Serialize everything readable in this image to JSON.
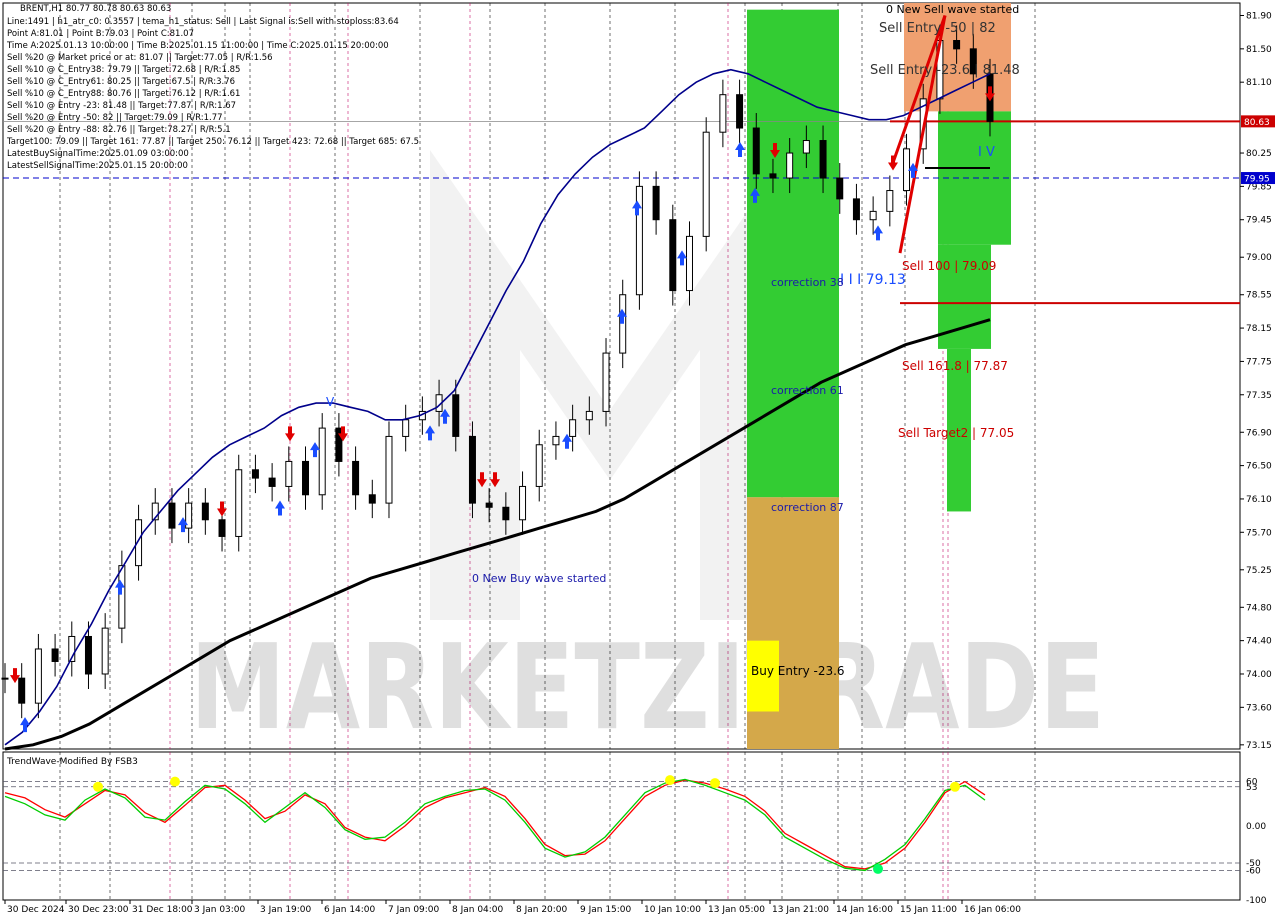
{
  "chart_data": [
    {
      "type": "line",
      "panel": "main",
      "symbol_header": "BRENT,H1  80.77 80.78 80.63 80.63",
      "info_lines": [
        "Line:1491 | h1_atr_c0: 0.3557 | tema_h1_status: Sell | Last Signal is:Sell with stoploss:83.64",
        "Point A:81.01 | Point B:79.03 | Point C:81.07",
        "Time A:2025.01.13 10:00:00 | Time B:2025.01.15 11:00:00 | Time C:2025.01.15 20:00:00",
        "Sell %20 @ Market price or at: 81.07 || Target:77.05 | R/R:1.56",
        "Sell %10 @ C_Entry38: 79.79 || Target:72.68 | R/R:1.85",
        "Sell %10 @ C_Entry61: 80.25 || Target:67.5 | R/R:3.76",
        "Sell %10 @ C_Entry88: 80.76 || Target:76.12 | R/R:1.61",
        "Sell %10 @ Entry -23: 81.48 || Target:77.87 | R/R:1.67",
        "Sell %20 @ Entry -50: 82 || Target:79.09 | R/R:1.77",
        "Sell %20 @ Entry -88: 82.76 || Target:78.27 | R/R:5.1",
        "Target100: 79.09 || Target 161: 77.87 || Target 250: 76.12 || Target 423: 72.68 || Target 685: 67.5",
        "LatestBuySignalTime:2025.01.09 03:00:00",
        "LatestSellSignalTime:2025.01.15 20:00:00"
      ],
      "y_ticks": [
        "81.90",
        "81.50",
        "81.10",
        "80.25",
        "79.85",
        "79.45",
        "79.00",
        "78.55",
        "78.15",
        "77.75",
        "77.35",
        "76.90",
        "76.50",
        "76.10",
        "75.70",
        "75.25",
        "74.80",
        "74.40",
        "74.00",
        "73.60",
        "73.15"
      ],
      "y_range": [
        73.1,
        82.05
      ],
      "x_ticks": [
        "30 Dec 2024",
        "30 Dec 23:00",
        "31 Dec 18:00",
        "3 Jan 03:00",
        "3 Jan 19:00",
        "6 Jan 14:00",
        "7 Jan 09:00",
        "8 Jan 04:00",
        "8 Jan 20:00",
        "9 Jan 15:00",
        "10 Jan 10:00",
        "13 Jan 05:00",
        "13 Jan 21:00",
        "14 Jan 16:00",
        "15 Jan 11:00",
        "16 Jan 06:00"
      ],
      "current_price": {
        "value": 80.63,
        "label": "80.63",
        "color": "#cc0000"
      },
      "dashed_level": {
        "value": 79.95,
        "label": "79.95",
        "color": "#0000cc"
      },
      "stop_level": {
        "value": 78.45,
        "color": "#cc0000"
      },
      "series": [
        {
          "name": "price",
          "color": "#000000",
          "values": [
            73.95,
            73.65,
            74.3,
            74.15,
            74.45,
            74.0,
            74.55,
            75.3,
            75.85,
            76.05,
            75.75,
            76.05,
            75.85,
            75.65,
            76.45,
            76.35,
            76.25,
            76.55,
            76.15,
            76.95,
            76.55,
            76.15,
            76.05,
            76.85,
            77.05,
            77.15,
            77.35,
            76.85,
            76.05,
            76.0,
            75.85,
            76.25,
            76.75,
            76.85,
            77.05,
            77.15,
            77.85,
            78.55,
            79.85,
            79.45,
            78.6,
            79.25,
            80.5,
            80.95,
            80.55,
            80.0,
            79.95,
            80.25,
            80.4,
            79.95,
            79.7,
            79.45,
            79.55,
            79.8,
            80.3,
            80.9,
            81.6,
            81.5,
            81.2,
            80.63
          ]
        },
        {
          "name": "ma-fast",
          "color": "#00008b",
          "values": [
            73.15,
            73.3,
            73.55,
            73.85,
            74.25,
            74.6,
            75.0,
            75.35,
            75.7,
            75.95,
            76.2,
            76.4,
            76.6,
            76.75,
            76.85,
            76.95,
            77.1,
            77.2,
            77.25,
            77.25,
            77.2,
            77.15,
            77.05,
            77.05,
            77.1,
            77.2,
            77.4,
            77.8,
            78.2,
            78.6,
            78.95,
            79.4,
            79.75,
            80.0,
            80.2,
            80.35,
            80.45,
            80.55,
            80.75,
            80.95,
            81.1,
            81.2,
            81.25,
            81.2,
            81.1,
            81.0,
            80.9,
            80.8,
            80.75,
            80.7,
            80.65,
            80.65,
            80.7,
            80.8,
            80.9,
            81.0,
            81.1,
            81.2
          ]
        },
        {
          "name": "ma-slow",
          "color": "#000000",
          "values": [
            73.1,
            73.15,
            73.25,
            73.4,
            73.6,
            73.8,
            74.0,
            74.2,
            74.4,
            74.55,
            74.7,
            74.85,
            75.0,
            75.15,
            75.25,
            75.35,
            75.45,
            75.55,
            75.65,
            75.75,
            75.85,
            75.95,
            76.1,
            76.3,
            76.5,
            76.7,
            76.9,
            77.1,
            77.3,
            77.5,
            77.65,
            77.8,
            77.95,
            78.05,
            78.15,
            78.25
          ]
        }
      ],
      "zones": [
        {
          "label": "correction 38",
          "price": 78.95,
          "color": "#33cc33"
        },
        {
          "label": "correction 61",
          "price": 77.55,
          "color": "#33cc33"
        },
        {
          "label": "correction 87",
          "price": 76.0,
          "color": "#d4a84a"
        },
        {
          "label": "Buy Entry -23.6",
          "price": 73.95,
          "color": "#ffff00"
        }
      ],
      "annotations": [
        "0 New Sell wave started",
        "Sell Entry -50 | 82",
        "Sell Entry -23.6 | 81.48",
        "I V",
        "Sell 100 | 79.09",
        "I I I 79.13",
        "Sell 161.8 | 77.87",
        "Sell Target2 | 77.05",
        "0 New Buy wave started",
        "V"
      ],
      "watermark": "MARKETZITRADE"
    },
    {
      "type": "line",
      "panel": "oscillator",
      "title": "TrendWave-Modified By FSB3",
      "y_ticks": [
        "60",
        "53",
        "0.00",
        "-50",
        "-60",
        "-100"
      ],
      "y_range": [
        -100,
        100
      ],
      "series": [
        {
          "name": "red line",
          "color": "#ff0000",
          "values": [
            45,
            38,
            22,
            12,
            30,
            48,
            42,
            18,
            5,
            28,
            52,
            55,
            35,
            10,
            20,
            42,
            30,
            -2,
            -15,
            -20,
            0,
            25,
            38,
            45,
            52,
            40,
            10,
            -25,
            -40,
            -38,
            -20,
            10,
            40,
            55,
            62,
            58,
            50,
            40,
            20,
            -10,
            -25,
            -40,
            -55,
            -58,
            -50,
            -30,
            5,
            45,
            60,
            42
          ]
        },
        {
          "name": "green line",
          "color": "#00cc00",
          "values": [
            40,
            30,
            15,
            8,
            35,
            50,
            38,
            12,
            8,
            33,
            55,
            50,
            30,
            5,
            25,
            45,
            25,
            -5,
            -18,
            -15,
            5,
            30,
            40,
            48,
            50,
            35,
            5,
            -30,
            -42,
            -35,
            -15,
            15,
            45,
            58,
            63,
            55,
            45,
            35,
            15,
            -15,
            -30,
            -45,
            -57,
            -60,
            -45,
            -25,
            10,
            48,
            55,
            35
          ]
        }
      ],
      "markers": [
        {
          "label": "overbought-dot",
          "color": "#ffff00"
        },
        {
          "label": "oversold-dot",
          "color": "#00ff66"
        }
      ]
    }
  ]
}
